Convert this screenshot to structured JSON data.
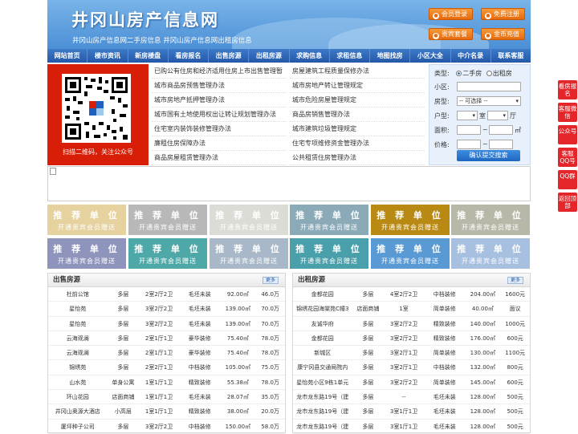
{
  "header": {
    "logo": "井冈山房产信息网",
    "subtitle": "井冈山房产信息网二手房信息    井冈山房产信息网出租房信息",
    "buttons": [
      "会员登录",
      "免费注册",
      "贵宾套餐",
      "金币充值"
    ]
  },
  "nav": [
    "网站首页",
    "楼市资讯",
    "新房楼盘",
    "看房报名",
    "出售房源",
    "出租房源",
    "求购信息",
    "求租信息",
    "地图找房",
    "小区大全",
    "中介名录",
    "联系客服"
  ],
  "qr": {
    "caption": "扫描二维码，关注公众号"
  },
  "news": [
    "已购公有住房和经济适用住房上市出售管理暂",
    "城市商品房预售管理办法",
    "城市房地产抵押管理办法",
    "城市国有土地使用权出让转让规划管理办法",
    "住宅室内装饰装修管理办法",
    "廉租住房保障办法",
    "商品房屋租赁管理办法",
    "房屋建筑工程质量保修办法",
    "城市房地产转让管理规定",
    "城市危险房屋管理规定",
    "商品房销售管理办法",
    "城市建筑垃圾管理规定",
    "住宅专项维修资金管理办法",
    "公共租赁住房管理办法"
  ],
  "search": {
    "type_label": "类型:",
    "opt1": "二手房",
    "opt2": "出租房",
    "area_label": "小区:",
    "room_label": "房型:",
    "room_select": "-- 可选择 --",
    "layout_label": "户型:",
    "shi": "室",
    "ting": "厅",
    "size_label": "面积:",
    "size_unit": "㎡",
    "price_label": "价格:",
    "tilde": "~",
    "submit": "确认提交搜索"
  },
  "ads": {
    "line1": "推 荐 单 位",
    "line2": "开通贵宾会员赠送",
    "colors": [
      "#e6d29e",
      "#b8b8b8",
      "#dcdcd6",
      "#8aaab8",
      "#b88a14",
      "#b8b8a8",
      "#8e94bc",
      "#4fa8a8",
      "#a8b8c8",
      "#4aa0aa",
      "#5a9ad4",
      "#a8c0e0"
    ]
  },
  "sale": {
    "title": "出售房源",
    "more": "更多",
    "rows": [
      [
        "杜前公馆",
        "多层",
        "2室2厅2卫",
        "毛坯未装",
        "92.00㎡",
        "46.0万"
      ],
      [
        "星怡苑",
        "多层",
        "3室2厅2卫",
        "毛坯未装",
        "139.00㎡",
        "70.0万"
      ],
      [
        "星怡苑",
        "多层",
        "3室2厅2卫",
        "毛坯未装",
        "139.00㎡",
        "70.0万"
      ],
      [
        "云海观澜",
        "多层",
        "2室1厅1卫",
        "豪华装修",
        "75.40㎡",
        "78.0万"
      ],
      [
        "云海观澜",
        "多层",
        "2室1厅1卫",
        "豪华装修",
        "75.40㎡",
        "78.0万"
      ],
      [
        "锦绣苑",
        "多层",
        "2室2厅1卫",
        "中档装修",
        "105.00㎡",
        "75.0万"
      ],
      [
        "山水苑",
        "单身公寓",
        "1室1厅1卫",
        "精致装修",
        "55.38㎡",
        "78.0万"
      ],
      [
        "环山花园",
        "店面商铺",
        "1室1厅1卫",
        "毛坯未装",
        "28.07㎡",
        "35.0万"
      ],
      [
        "井冈山奥源大酒店",
        "小高层",
        "1室1厅1卫",
        "精致装修",
        "38.00㎡",
        "20.0万"
      ],
      [
        "厦坪种子公司",
        "多层",
        "3室2厅2卫",
        "中档装修",
        "150.00㎡",
        "58.0万"
      ]
    ]
  },
  "rent": {
    "title": "出租房源",
    "more": "更多",
    "rows": [
      [
        "金都花园",
        "多层",
        "4室2厅2卫",
        "中档装修",
        "204.00㎡",
        "1600元"
      ],
      [
        "锦绣花园海棠苑C幢3",
        "店面商铺",
        "1室",
        "简单装修",
        "40.00㎡",
        "面议"
      ],
      [
        "友诚华府",
        "多层",
        "3室2厅2卫",
        "精致装修",
        "140.00㎡",
        "1000元"
      ],
      [
        "金都花园",
        "多层",
        "3室2厅2卫",
        "精致装修",
        "176.00㎡",
        "600元"
      ],
      [
        "新城区",
        "多层",
        "3室2厅1卫",
        "简单装修",
        "130.00㎡",
        "1100元"
      ],
      [
        "康宁冈县交通局院内",
        "多层",
        "3室2厅1卫",
        "中档装修",
        "132.00㎡",
        "800元"
      ],
      [
        "星怡苑小区9栋1单元",
        "多层",
        "3室2厅2卫",
        "简单装修",
        "145.00㎡",
        "600元"
      ],
      [
        "龙市龙东路19号（建",
        "多层",
        "--",
        "毛坯未装",
        "128.00㎡",
        "500元"
      ],
      [
        "龙市龙东路19号（建",
        "多层",
        "3室1厅1卫",
        "毛坯未装",
        "128.00㎡",
        "500元"
      ],
      [
        "龙市龙东路19号（建",
        "多层",
        "3室1厅1卫",
        "毛坯未装",
        "128.00㎡",
        "500元"
      ]
    ]
  },
  "side": [
    "看房报名",
    "客服微信",
    "公众号",
    "客服QQ号",
    "QQ群",
    "返回顶部"
  ]
}
